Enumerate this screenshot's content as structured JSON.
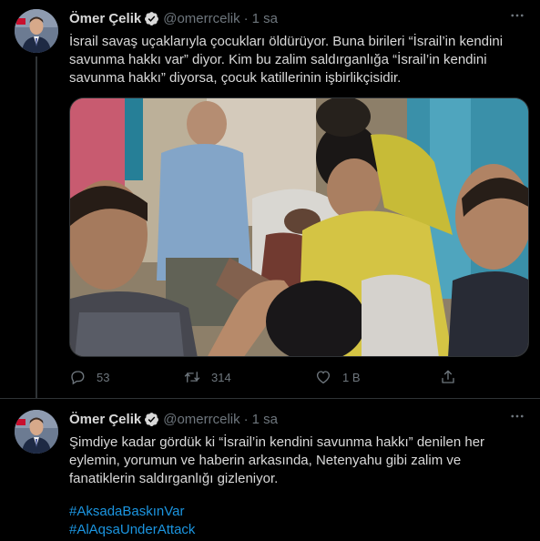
{
  "tweets": [
    {
      "author_name": "Ömer Çelik",
      "handle": "@omerrcelik",
      "separator": "·",
      "time": "1 sa",
      "text": "İsrail savaş uçaklarıyla çocukları öldürüyor. Buna birileri “İsrail’in kendini savunma hakkı var” diyor.  Kim bu zalim saldırganlığa “İsrail’in kendini savunma hakkı” diyorsa, çocuk katillerinin işbirlikçisidir.",
      "actions": {
        "reply_count": "53",
        "retweet_count": "314",
        "like_count": "1 B"
      }
    },
    {
      "author_name": "Ömer Çelik",
      "handle": "@omerrcelik",
      "separator": "·",
      "time": "1 sa",
      "text": "Şimdiye kadar gördük ki “İsrail’in kendini savunma hakkı” denilen her eylemin, yorumun ve haberin arkasında, Netenyahu gibi zalim ve fanatiklerin saldırganlığı gizleniyor.",
      "hashtags": [
        "#AksadaBaskınVar",
        "#AlAqsaUnderAttack"
      ]
    }
  ],
  "colors": {
    "background": "#000000",
    "text": "#d9d9d9",
    "muted": "#6e767d",
    "accent": "#1b95e0",
    "divider": "#2f3336"
  },
  "icons": [
    "verified-badge-icon",
    "more-icon",
    "reply-icon",
    "retweet-icon",
    "like-icon",
    "share-icon"
  ]
}
